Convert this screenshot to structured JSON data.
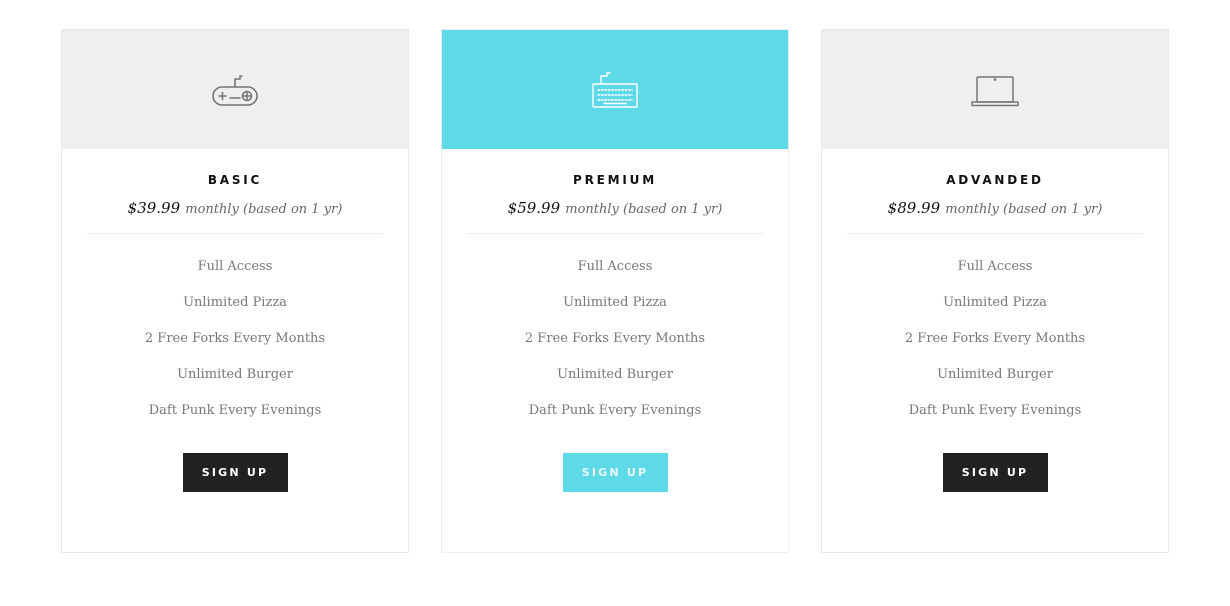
{
  "plans": [
    {
      "name": "BASIC",
      "price": "$39.99",
      "period": "monthly (based on 1 yr)",
      "icon": "gamepad-icon",
      "features": [
        "Full Access",
        "Unlimited Pizza",
        "2 Free Forks Every Months",
        "Unlimited Burger",
        "Daft Punk Every Evenings"
      ],
      "cta": "SIGN UP"
    },
    {
      "name": "PREMIUM",
      "price": "$59.99",
      "period": "monthly (based on 1 yr)",
      "icon": "keyboard-icon",
      "features": [
        "Full Access",
        "Unlimited Pizza",
        "2 Free Forks Every Months",
        "Unlimited Burger",
        "Daft Punk Every Evenings"
      ],
      "cta": "SIGN UP"
    },
    {
      "name": "ADVANDED",
      "price": "$89.99",
      "period": "monthly (based on 1 yr)",
      "icon": "laptop-icon",
      "features": [
        "Full Access",
        "Unlimited Pizza",
        "2 Free Forks Every Months",
        "Unlimited Burger",
        "Daft Punk Every Evenings"
      ],
      "cta": "SIGN UP"
    }
  ],
  "colors": {
    "accent": "#5dd9e8",
    "dark_button": "#222222",
    "header_gray": "#efefef",
    "icon_gray": "#777777"
  }
}
